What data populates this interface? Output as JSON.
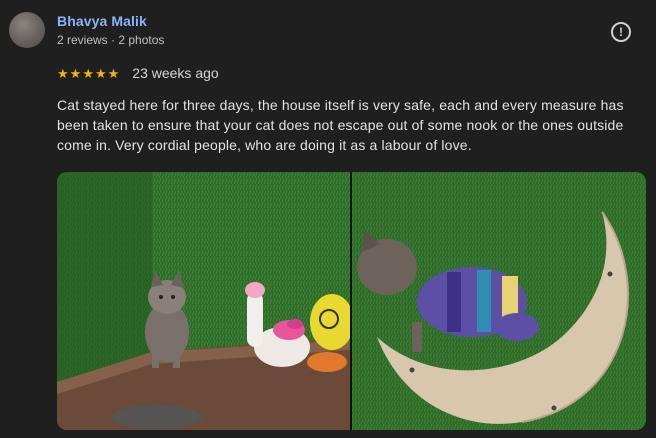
{
  "author": {
    "name": "Bhavya Malik",
    "meta": "2 reviews · 2 photos"
  },
  "report": {
    "icon": "report-icon",
    "glyph": "!"
  },
  "rating": {
    "value": 5,
    "max": 5,
    "star_glyph": "★",
    "color": "#f4b400",
    "date": "23 weeks ago"
  },
  "review": {
    "text": "Cat stayed here for three days, the house itself is very safe, each and every measure has been taken to ensure that your cat does not escape out of some nook or the ones outside come in. Very cordial people, who are doing it as a labour of love."
  },
  "colors": {
    "background": "#1f1f1f",
    "author_link": "#8ab4f8",
    "text": "#e3e3e3"
  },
  "photos": [
    {
      "name": "photo-cat-with-toys"
    },
    {
      "name": "photo-cat-on-moon-bed"
    }
  ]
}
